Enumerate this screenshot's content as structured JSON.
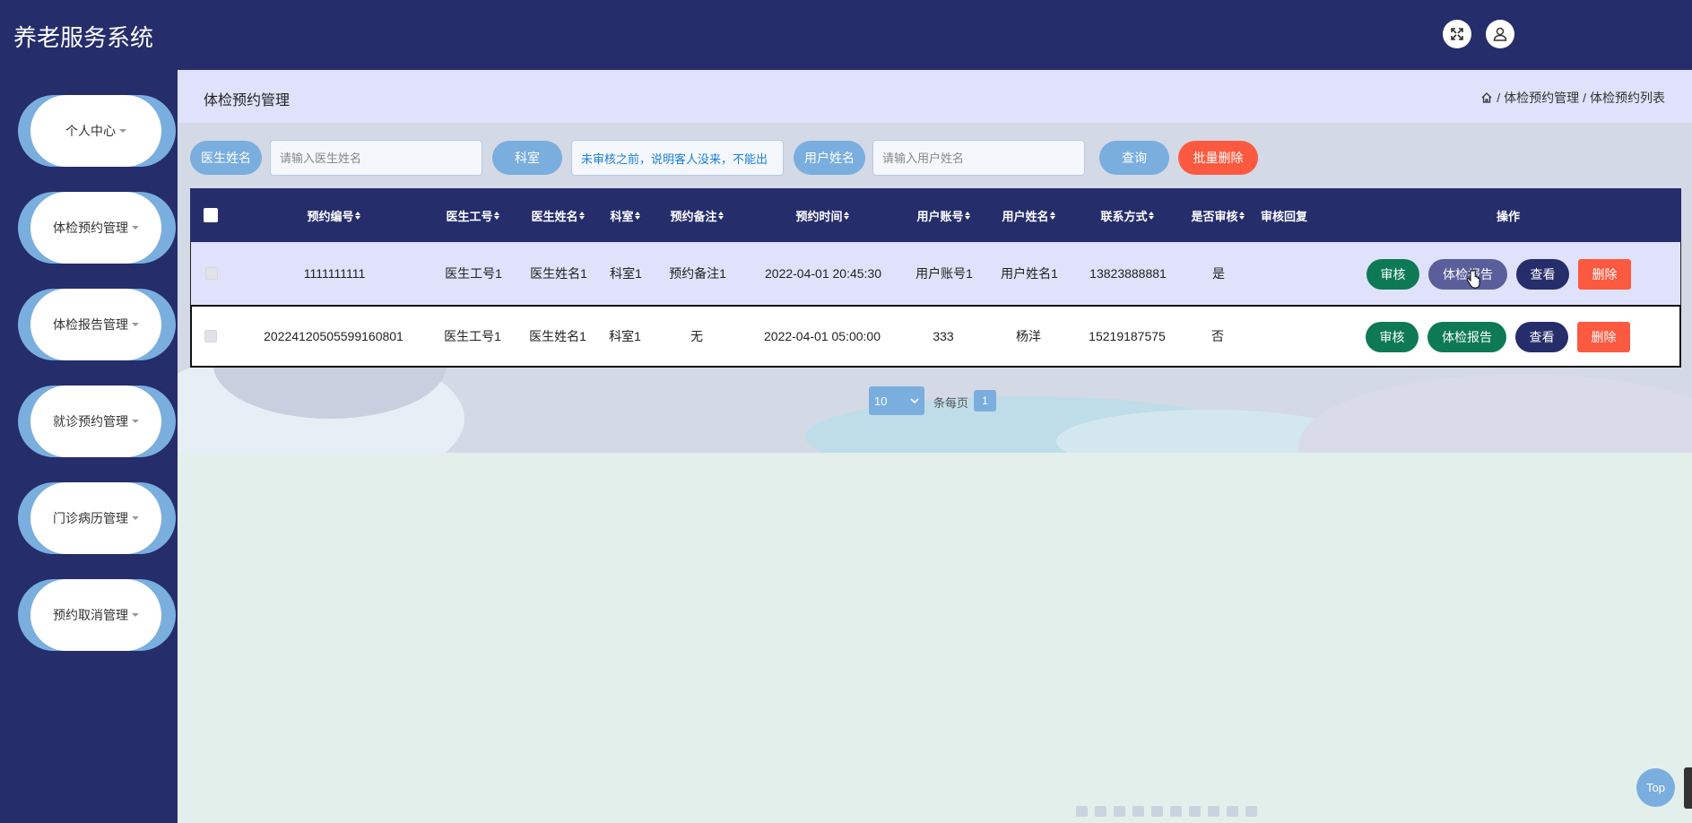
{
  "app": {
    "title": "养老服务系统"
  },
  "header": {
    "fullscreen_icon": "fullscreen-icon",
    "user_icon": "user-icon"
  },
  "sidebar": {
    "items": [
      {
        "label": "个人中心"
      },
      {
        "label": "体检预约管理"
      },
      {
        "label": "体检报告管理"
      },
      {
        "label": "就诊预约管理"
      },
      {
        "label": "门诊病历管理"
      },
      {
        "label": "预约取消管理"
      }
    ]
  },
  "page": {
    "title": "体检预约管理",
    "breadcrumb": {
      "level1": "体检预约管理",
      "level2": "体检预约列表",
      "separator": "/"
    }
  },
  "search": {
    "doctor_label": "医生姓名",
    "doctor_placeholder": "请输入医生姓名",
    "dept_label": "科室",
    "dept_value": "未审核之前，说明客人没来，不能出",
    "user_label": "用户姓名",
    "user_placeholder": "请输入用户姓名",
    "query_button": "查询",
    "batch_delete_button": "批量删除"
  },
  "table": {
    "columns": [
      "预约编号",
      "医生工号",
      "医生姓名",
      "科室",
      "预约备注",
      "预约时间",
      "用户账号",
      "用户姓名",
      "联系方式",
      "是否审核",
      "审核回复",
      "操作"
    ],
    "rows": [
      {
        "id": "1111111111",
        "doctor_no": "医生工号1",
        "doctor_name": "医生姓名1",
        "dept": "科室1",
        "remark": "预约备注1",
        "time": "2022-04-01 20:45:30",
        "account": "用户账号1",
        "user_name": "用户姓名1",
        "phone": "13823888881",
        "audited": "是",
        "reply": ""
      },
      {
        "id": "20224120505599160801",
        "doctor_no": "医生工号1",
        "doctor_name": "医生姓名1",
        "dept": "科室1",
        "remark": "无",
        "time": "2022-04-01 05:00:00",
        "account": "333",
        "user_name": "杨洋",
        "phone": "15219187575",
        "audited": "否",
        "reply": ""
      }
    ],
    "actions": {
      "audit": "审核",
      "report": "体检报告",
      "view": "查看",
      "delete": "删除"
    }
  },
  "pagination": {
    "page_size": "10",
    "per_page_label": "条每页",
    "current_page": "1"
  },
  "floating": {
    "top_button": "Top"
  },
  "colors": {
    "header_bg": "#252d6b",
    "accent": "#7aaede",
    "audit_btn": "#0e7a55",
    "report_btn_active": "#5a5f9c",
    "view_btn": "#252d6b",
    "delete_btn": "#fb5a40",
    "batch_delete_btn": "#fb5a40"
  }
}
